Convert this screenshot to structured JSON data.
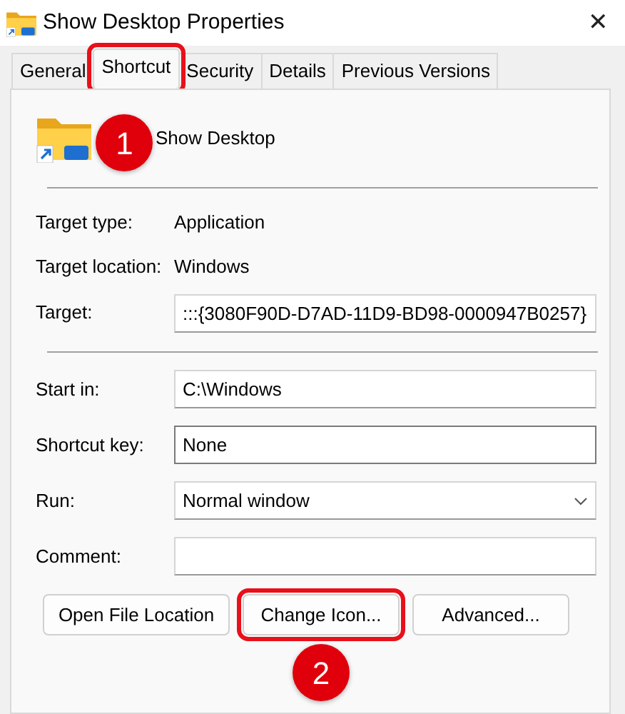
{
  "window": {
    "title": "Show Desktop Properties",
    "close": "✕"
  },
  "tabs": [
    {
      "label": "General",
      "selected": false
    },
    {
      "label": "Shortcut",
      "selected": true
    },
    {
      "label": "Security",
      "selected": false
    },
    {
      "label": "Details",
      "selected": false
    },
    {
      "label": "Previous Versions",
      "selected": false
    }
  ],
  "shortcut_name": "Show Desktop",
  "info": [
    {
      "label": "Target type:",
      "value": "Application"
    },
    {
      "label": "Target location:",
      "value": "Windows"
    }
  ],
  "target": {
    "label": "Target:",
    "value": ":::{3080F90D-D7AD-11D9-BD98-0000947B0257}"
  },
  "fields": [
    {
      "kind": "text",
      "label": "Start in:",
      "value": "C:\\Windows"
    },
    {
      "kind": "text",
      "label": "Shortcut key:",
      "value": "None"
    },
    {
      "kind": "select",
      "label": "Run:",
      "value": "Normal window"
    },
    {
      "kind": "text",
      "label": "Comment:"
    }
  ],
  "buttons": [
    {
      "label": "Open File Location",
      "highlighted": false
    },
    {
      "label": "Change Icon...",
      "highlighted": true
    },
    {
      "label": "Advanced...",
      "highlighted": false
    }
  ],
  "annotations": [
    {
      "label": "1"
    },
    {
      "label": "2"
    }
  ]
}
